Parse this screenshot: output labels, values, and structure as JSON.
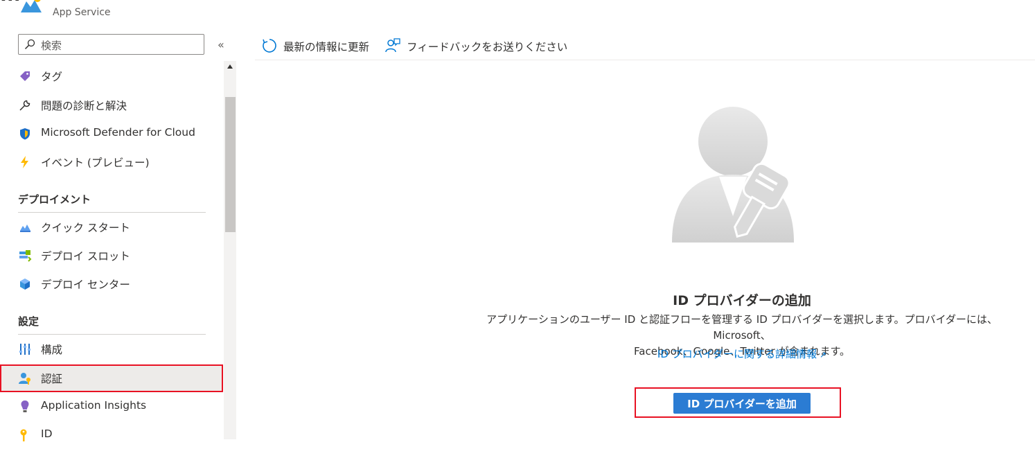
{
  "header": {
    "resource_title": "...",
    "resource_type": "App Service"
  },
  "sidebar": {
    "search_placeholder": "検索",
    "collapse_glyph": "«",
    "items_top": [
      {
        "label": "タグ",
        "icon": "tag-icon"
      },
      {
        "label": "問題の診断と解決",
        "icon": "wrench-icon"
      },
      {
        "label": "Microsoft Defender for Cloud",
        "icon": "defender-shield-icon"
      },
      {
        "label": "イベント (プレビュー)",
        "icon": "lightning-icon"
      }
    ],
    "deployment_section": "デプロイメント",
    "deployment_items": [
      {
        "label": "クイック スタート",
        "icon": "cloud-quickstart-icon"
      },
      {
        "label": "デプロイ スロット",
        "icon": "deployment-slots-icon"
      },
      {
        "label": "デプロイ センター",
        "icon": "deployment-center-cube-icon"
      }
    ],
    "settings_section": "設定",
    "settings_items": [
      {
        "label": "構成",
        "icon": "configuration-bars-icon"
      },
      {
        "label": "認証",
        "icon": "authentication-user-icon",
        "selected": true
      },
      {
        "label": "Application Insights",
        "icon": "lightbulb-icon"
      },
      {
        "label": "ID",
        "icon": "identity-key-icon"
      }
    ]
  },
  "toolbar": {
    "refresh_label": "最新の情報に更新",
    "feedback_label": "フィードバックをお送りください"
  },
  "main": {
    "title": "ID プロバイダーの追加",
    "description_line1": "アプリケーションのユーザー ID と認証フローを管理する ID プロバイダーを選択します。プロバイダーには、Microsoft、",
    "description_line2": "Facebook、Google、Twitter が含まれます。",
    "learn_more": "ID プロバイダーに関する詳細情報",
    "add_button": "ID プロバイダーを追加"
  },
  "colors": {
    "accent": "#2b7cd3",
    "link": "#0078d4",
    "highlight": "#e81123",
    "selected_bg": "#edebe9"
  }
}
